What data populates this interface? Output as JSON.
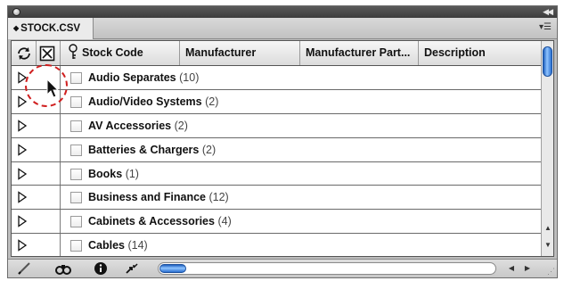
{
  "window": {
    "tab_title": "STOCK.CSV",
    "tab_arrows_icon": "double-arrow-icon",
    "collapse_icon": "collapse-arrows-icon",
    "panel_menu_icon": "panel-menu-icon"
  },
  "table": {
    "columns": [
      "Stock Code",
      "Manufacturer",
      "Manufacturer Part...",
      "Description"
    ],
    "rows": [
      {
        "label": "Audio Separates",
        "count": "(10)"
      },
      {
        "label": "Audio/Video Systems",
        "count": "(2)"
      },
      {
        "label": "AV Accessories",
        "count": "(2)"
      },
      {
        "label": "Batteries & Chargers",
        "count": "(2)"
      },
      {
        "label": "Books",
        "count": "(1)"
      },
      {
        "label": "Business and Finance",
        "count": "(12)"
      },
      {
        "label": "Cabinets & Accessories",
        "count": "(4)"
      },
      {
        "label": "Cables",
        "count": "(14)"
      }
    ]
  },
  "toolbar": {
    "icons": [
      "pen-icon",
      "binoculars-icon",
      "info-icon",
      "arrows-icon"
    ]
  },
  "colors": {
    "scroll_accent": "#2a6fd0",
    "annotation_circle": "#d02020"
  }
}
